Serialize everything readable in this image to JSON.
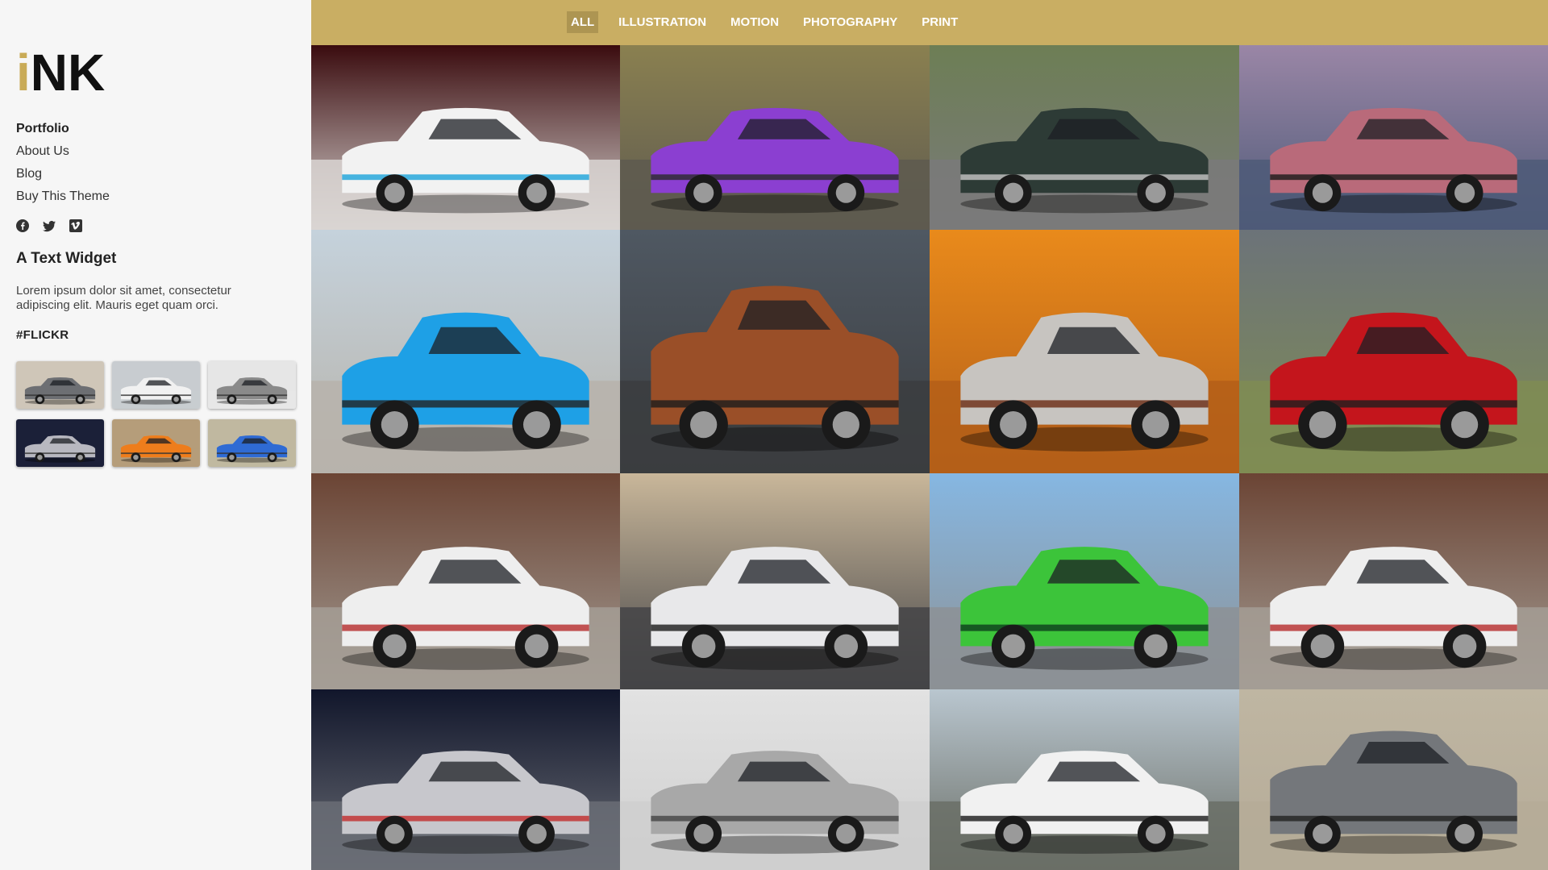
{
  "logo": {
    "accent_letter": "i",
    "rest": "NK"
  },
  "nav": {
    "items": [
      {
        "label": "Portfolio",
        "active": true
      },
      {
        "label": "About Us",
        "active": false
      },
      {
        "label": "Blog",
        "active": false
      },
      {
        "label": "Buy This Theme",
        "active": false
      }
    ]
  },
  "social": [
    "facebook-icon",
    "twitter-icon",
    "vimeo-icon"
  ],
  "widget": {
    "title": "A Text Widget",
    "text": "Lorem ipsum dolor sit amet, consectetur adipiscing elit. Mauris eget quam orci."
  },
  "flickr": {
    "title": "#FLICKR",
    "thumbs": [
      {
        "bg": "#cfc6b8",
        "car": "#6d6f73"
      },
      {
        "bg": "#c8ccd0",
        "car": "#f1f1f1"
      },
      {
        "bg": "#e6e6e6",
        "car": "#8a8a8a"
      },
      {
        "bg": "#1b2038",
        "car": "#b8b8c0"
      },
      {
        "bg": "#b59d7a",
        "car": "#ee7d1c"
      },
      {
        "bg": "#c0b8a0",
        "car": "#2f6bd4"
      }
    ]
  },
  "filters": {
    "items": [
      {
        "label": "ALL",
        "active": true
      },
      {
        "label": "ILLUSTRATION",
        "active": false
      },
      {
        "label": "MOTION",
        "active": false
      },
      {
        "label": "PHOTOGRAPHY",
        "active": false
      },
      {
        "label": "PRINT",
        "active": false
      }
    ]
  },
  "colors": {
    "accent": "#c9ab57",
    "topbar": "#c9ae63",
    "topbar_active": "#ad9552",
    "sidebar": "#f6f6f6"
  },
  "portfolio": [
    {
      "name": "white-hypercar",
      "sky": "#3a0b0e",
      "ground": "#d9d5d2",
      "car": "#f2f2f2",
      "trim": "#1aa3d9"
    },
    {
      "name": "purple-sedan",
      "sky": "#8a8050",
      "ground": "#5e5a4f",
      "car": "#8b3fd1",
      "trim": "#2b2b2b"
    },
    {
      "name": "green-roadster",
      "sky": "#6d7e55",
      "ground": "#7a7a7a",
      "car": "#2d3b36",
      "trim": "#c7c7c7"
    },
    {
      "name": "pink-gullwing",
      "sky": "#9a86a6",
      "ground": "#4e5a78",
      "car": "#b96a7a",
      "trim": "#1a1a1a"
    },
    {
      "name": "blue-sportscar",
      "sky": "#c5d2dc",
      "ground": "#b7b3ab",
      "car": "#1ea0e6",
      "trim": "#222"
    },
    {
      "name": "orange-suv",
      "sky": "#4f5862",
      "ground": "#3b3d40",
      "car": "#9a4f28",
      "trim": "#1c1c1c"
    },
    {
      "name": "silver-classic",
      "sky": "#e98a1b",
      "ground": "#b45f19",
      "car": "#c7c4c0",
      "trim": "#6a2b12"
    },
    {
      "name": "red-coupe",
      "sky": "#6c7379",
      "ground": "#7f8c54",
      "car": "#c4151c",
      "trim": "#1e1e1e"
    },
    {
      "name": "white-sedan-street",
      "sky": "#6b4434",
      "ground": "#a49d95",
      "car": "#eeeeee",
      "trim": "#b52b2b"
    },
    {
      "name": "white-muscle-car",
      "sky": "#c9b79a",
      "ground": "#444447",
      "car": "#e8e8ea",
      "trim": "#1a1a1a"
    },
    {
      "name": "green-racecar",
      "sky": "#86b7e2",
      "ground": "#8c9195",
      "car": "#3cc43a",
      "trim": "#0c3d1d"
    },
    {
      "name": "white-sedan-street-2",
      "sky": "#6b4434",
      "ground": "#a49d95",
      "car": "#eeeeee",
      "trim": "#b52b2b"
    },
    {
      "name": "silver-concept",
      "sky": "#11162b",
      "ground": "#6a6d75",
      "car": "#c7c7cc",
      "trim": "#c22c2c"
    },
    {
      "name": "silver-sedan",
      "sky": "#e2e2e2",
      "ground": "#cfcfcf",
      "car": "#a8a8a8",
      "trim": "#444"
    },
    {
      "name": "white-bmw",
      "sky": "#b9c6cf",
      "ground": "#6a6e66",
      "car": "#f1f1f1",
      "trim": "#1a1a1a"
    },
    {
      "name": "grey-suv",
      "sky": "#bfb6a2",
      "ground": "#b5ab98",
      "car": "#74777b",
      "trim": "#222"
    }
  ]
}
